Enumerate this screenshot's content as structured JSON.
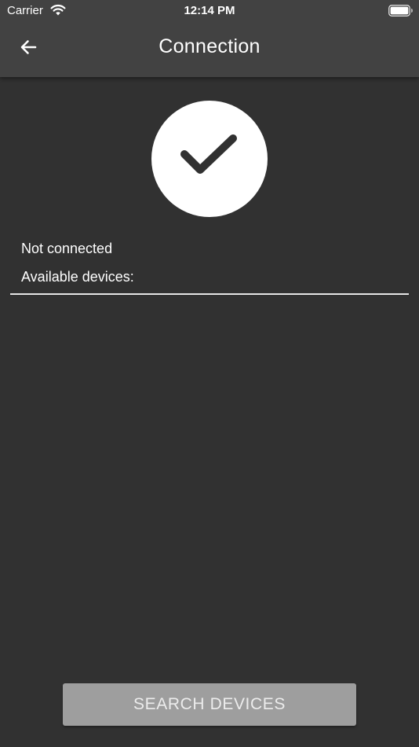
{
  "status_bar": {
    "carrier": "Carrier",
    "time": "12:14 PM",
    "wifi_icon": "wifi-icon",
    "battery_icon": "battery-icon"
  },
  "header": {
    "title": "Connection",
    "back_icon": "arrow-back-icon"
  },
  "connection": {
    "status_icon": "checkmark-icon",
    "status_text": "Not connected",
    "devices_label": "Available devices:",
    "devices": []
  },
  "actions": {
    "search_label": "SEARCH DEVICES"
  },
  "colors": {
    "background": "#313131",
    "appbar": "#424242",
    "button": "#9e9e9e",
    "button_text": "#ececec",
    "icon_circle": "#ffffff",
    "checkmark": "#313131"
  }
}
